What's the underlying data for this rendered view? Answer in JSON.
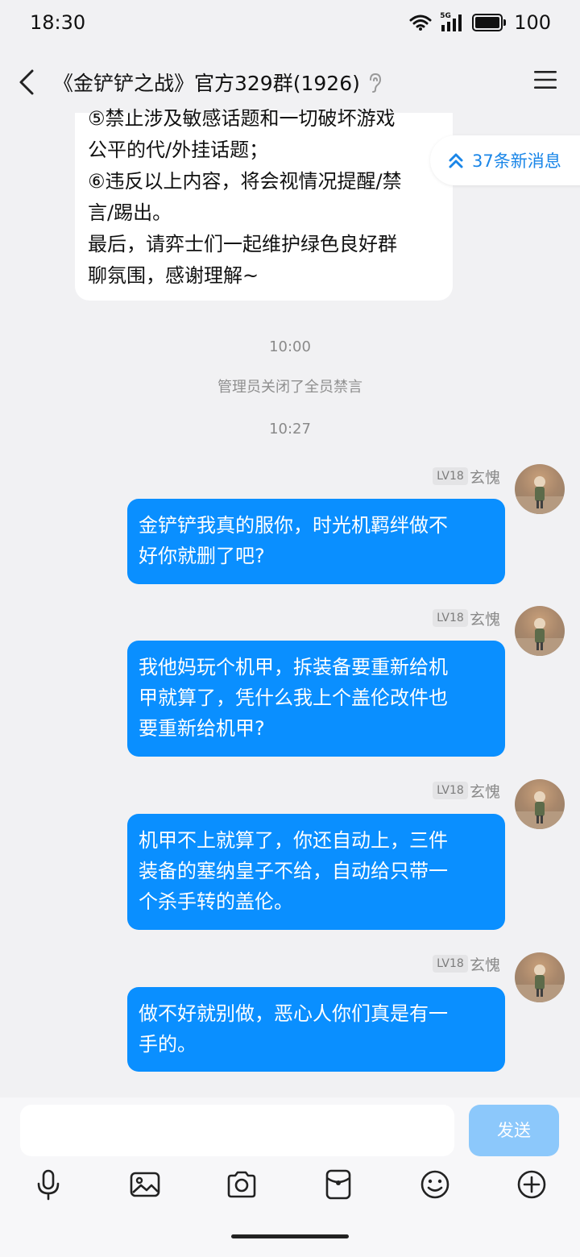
{
  "status_bar": {
    "time": "18:30",
    "network": "5G",
    "battery": "100"
  },
  "header": {
    "title": "《金铲铲之战》官方329群(1926)"
  },
  "notice": {
    "lines": [
      "⑤禁止涉及敏感话题和一切破坏游戏",
      "公平的代/外挂话题；",
      "⑥违反以上内容，将会视情况提醒/禁",
      "言/踢出。",
      "最后，请弈士们一起维护绿色良好群",
      "聊氛围，感谢理解~"
    ]
  },
  "new_messages": {
    "label": "37条新消息"
  },
  "system": {
    "time1": "10:00",
    "event1": "管理员关闭了全员禁言",
    "time2": "10:27"
  },
  "messages": [
    {
      "level": "LV18",
      "nick": "玄愧",
      "lines": [
        "金铲铲我真的服你，时光机羁绊做不",
        "好你就删了吧?"
      ]
    },
    {
      "level": "LV18",
      "nick": "玄愧",
      "lines": [
        "我他妈玩个机甲，拆装备要重新给机",
        "甲就算了，凭什么我上个盖伦改件也",
        "要重新给机甲?"
      ]
    },
    {
      "level": "LV18",
      "nick": "玄愧",
      "lines": [
        "机甲不上就算了，你还自动上，三件",
        "装备的塞纳皇子不给，自动给只带一",
        "个杀手转的盖伦。"
      ]
    },
    {
      "level": "LV18",
      "nick": "玄愧",
      "lines": [
        "做不好就别做，恶心人你们真是有一",
        "手的。"
      ]
    }
  ],
  "input": {
    "placeholder": "",
    "send_label": "发送"
  },
  "toolbar": [
    "mic-icon",
    "image-icon",
    "camera-icon",
    "red-packet-icon",
    "emoji-icon",
    "plus-icon"
  ]
}
